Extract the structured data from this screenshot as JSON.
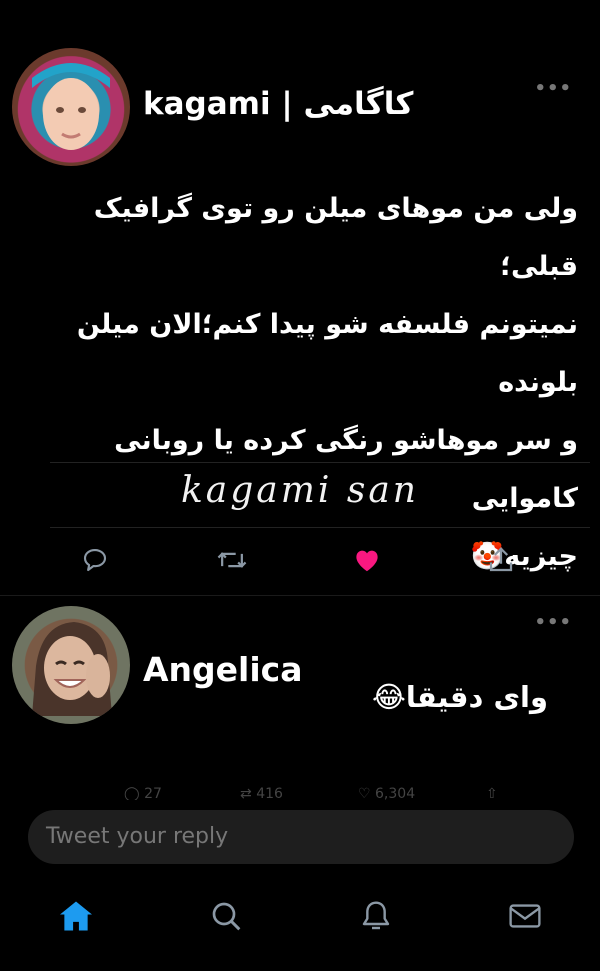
{
  "tweet": {
    "display_name": "kagami | کاگامی",
    "text_lines": [
      "ولی من موهای میلن رو توی گرافیک قبلی؛",
      "نمیتونم فلسفه شو پیدا کنم؛الان میلن بلونده",
      "و سر موهاشو رنگی کرده یا روبانی کاموایی",
      "چیزیه"
    ],
    "emoji": "🤡",
    "signature": "kagami san",
    "liked": true,
    "icons": [
      "reply-icon",
      "retweet-icon",
      "heart-icon",
      "share-icon"
    ]
  },
  "reply": {
    "display_name": "Angelica",
    "text": "وای دقیقا",
    "emoji": "😂",
    "stats": {
      "replies": "27",
      "retweets": "416",
      "likes": "6,304"
    }
  },
  "composer": {
    "placeholder": "Tweet your reply"
  },
  "bottom_nav": [
    "home-icon",
    "search-icon",
    "notifications-icon",
    "messages-icon"
  ],
  "colors": {
    "background": "#000000",
    "like": "#f91880",
    "accent": "#1d9bf0",
    "icon_gray": "#8b98a5"
  }
}
